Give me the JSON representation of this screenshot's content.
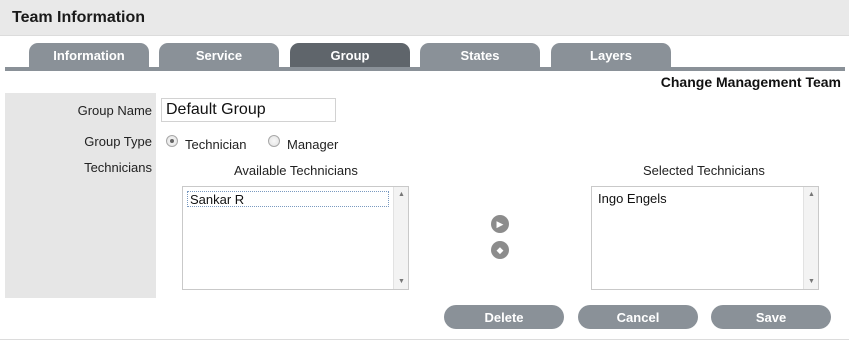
{
  "header": {
    "title": "Team Information"
  },
  "tabs": [
    {
      "label": "Information",
      "active": false
    },
    {
      "label": "Service",
      "active": false
    },
    {
      "label": "Group",
      "active": true
    },
    {
      "label": "States",
      "active": false
    },
    {
      "label": "Layers",
      "active": false
    }
  ],
  "team_name": "Change Management Team",
  "form": {
    "group_name_label": "Group Name",
    "group_name_value": "Default Group",
    "group_type_label": "Group Type",
    "group_type_options": [
      {
        "label": "Technician",
        "checked": true
      },
      {
        "label": "Manager",
        "checked": false
      }
    ],
    "technicians_label": "Technicians"
  },
  "available": {
    "heading": "Available Technicians",
    "items": [
      "Sankar R"
    ]
  },
  "selected": {
    "heading": "Selected Technicians",
    "items": [
      "Ingo Engels"
    ]
  },
  "icons": {
    "move_right": "play-arrow-icon",
    "move_left": "diamond-arrow-icon"
  },
  "colors": {
    "tab": "#8a9198",
    "tab_active": "#5f656b",
    "button": "#8a9198",
    "header_bg": "#e9e9e9",
    "label_panel": "#e6e6e6"
  },
  "buttons": {
    "delete": "Delete",
    "cancel": "Cancel",
    "save": "Save"
  }
}
